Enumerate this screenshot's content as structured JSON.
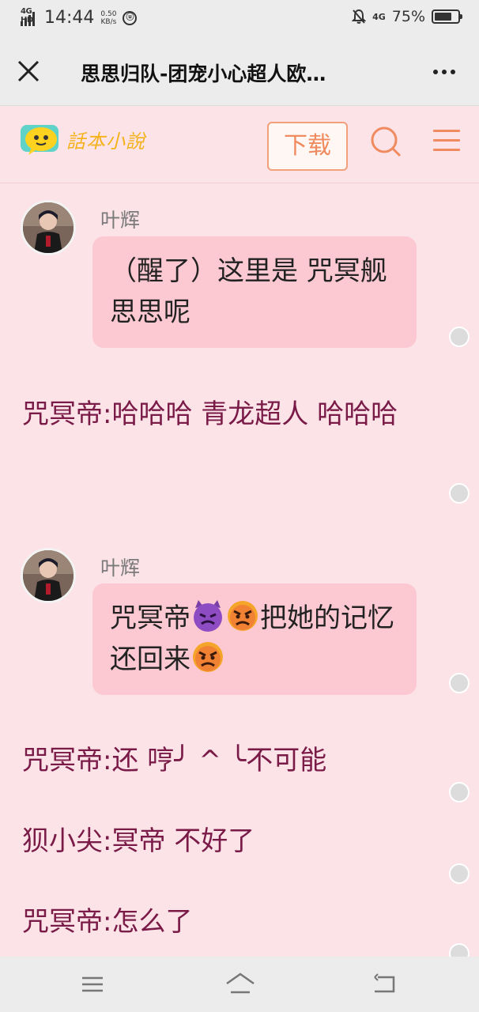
{
  "status": {
    "network": "4G HD",
    "time": "14:44",
    "speed_value": "0.50",
    "speed_unit": "KB/s",
    "network_right": "4G",
    "battery": "75%",
    "battery_level": 0.75
  },
  "titlebar": {
    "title": "思思归队-团宠小心超人欧…"
  },
  "header": {
    "logo_text": "話本小說",
    "download_label": "下载"
  },
  "messages": [
    {
      "speaker": "叶辉",
      "text": "（醒了）这里是 咒冥舰 思思呢"
    },
    {
      "narration": "咒冥帝:哈哈哈 青龙超人 哈哈哈"
    },
    {
      "speaker": "叶辉",
      "text_a": "咒冥帝",
      "text_b": "把她的记忆还回来"
    },
    {
      "narration": "咒冥帝:还 哼╯ ^ ╰不可能"
    },
    {
      "narration": "狈小尖:冥帝 不好了"
    },
    {
      "narration": "咒冥帝:怎么了"
    }
  ],
  "icons": {
    "close": "close-icon",
    "more": "more-icon",
    "search": "search-icon",
    "menu": "menu-icon",
    "devil": "devil-emoji",
    "angry": "angry-emoji",
    "nav_menu": "nav-menu-icon",
    "nav_home": "home-icon",
    "nav_back": "back-icon"
  },
  "colors": {
    "accent": "#f08a5f",
    "narration": "#7a1a47",
    "bubble": "#fcc9d3",
    "background": "#fbe3e8"
  }
}
